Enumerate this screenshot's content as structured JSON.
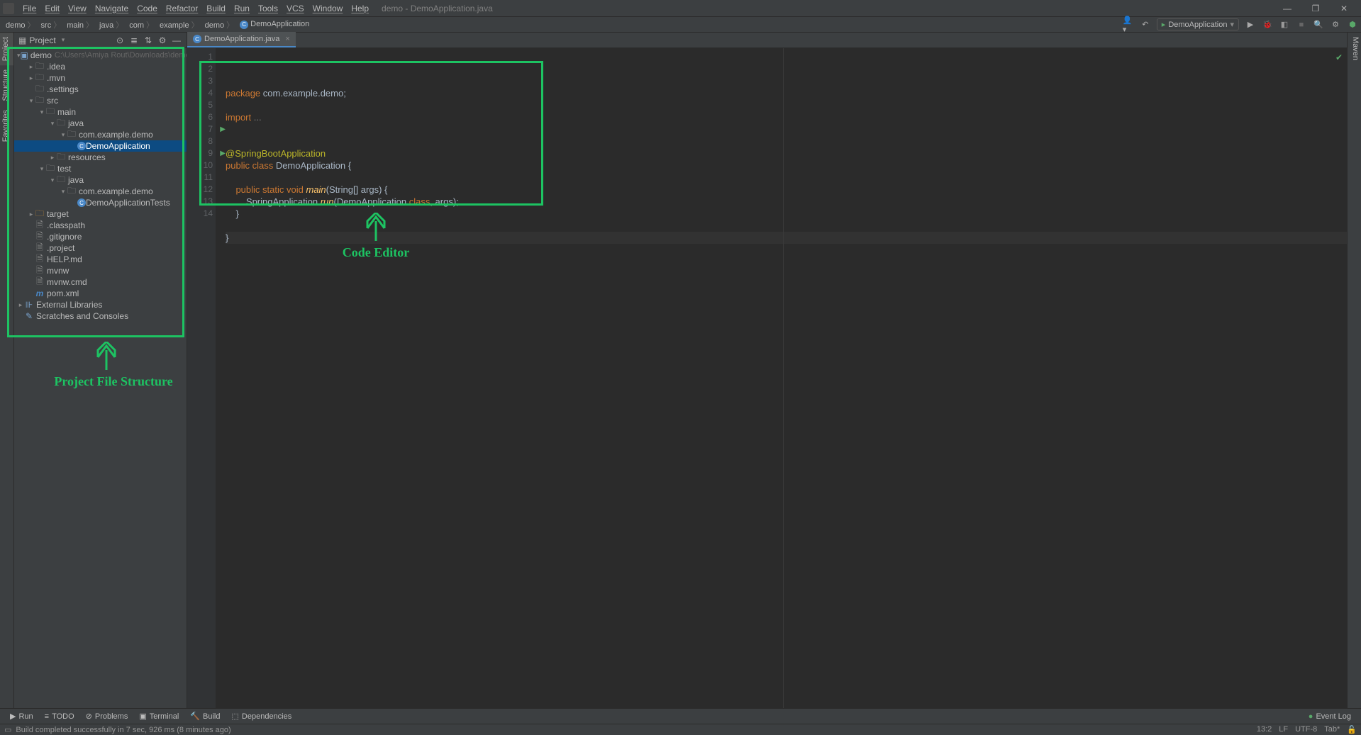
{
  "window": {
    "title": "demo - DemoApplication.java"
  },
  "menu": [
    "File",
    "Edit",
    "View",
    "Navigate",
    "Code",
    "Refactor",
    "Build",
    "Run",
    "Tools",
    "VCS",
    "Window",
    "Help"
  ],
  "breadcrumbs": [
    "demo",
    "src",
    "main",
    "java",
    "com",
    "example",
    "demo",
    "DemoApplication"
  ],
  "runConfig": {
    "name": "DemoApplication"
  },
  "projectHeader": {
    "label": "Project"
  },
  "tree": [
    {
      "d": 0,
      "arrow": "▾",
      "icon": "module",
      "label": "demo",
      "path": "C:\\Users\\Amiya Rout\\Downloads\\demo"
    },
    {
      "d": 1,
      "arrow": "▸",
      "icon": "folder",
      "label": ".idea"
    },
    {
      "d": 1,
      "arrow": "▸",
      "icon": "folder",
      "label": ".mvn"
    },
    {
      "d": 1,
      "arrow": " ",
      "icon": "folder",
      "label": ".settings"
    },
    {
      "d": 1,
      "arrow": "▾",
      "icon": "folder",
      "label": "src"
    },
    {
      "d": 2,
      "arrow": "▾",
      "icon": "folder",
      "label": "main"
    },
    {
      "d": 3,
      "arrow": "▾",
      "icon": "folder",
      "label": "java"
    },
    {
      "d": 4,
      "arrow": "▾",
      "icon": "folder",
      "label": "com.example.demo"
    },
    {
      "d": 5,
      "arrow": " ",
      "icon": "class",
      "label": "DemoApplication",
      "selected": true
    },
    {
      "d": 3,
      "arrow": "▸",
      "icon": "folder",
      "label": "resources"
    },
    {
      "d": 2,
      "arrow": "▾",
      "icon": "folder",
      "label": "test"
    },
    {
      "d": 3,
      "arrow": "▾",
      "icon": "folder",
      "label": "java"
    },
    {
      "d": 4,
      "arrow": "▾",
      "icon": "folder",
      "label": "com.example.demo"
    },
    {
      "d": 5,
      "arrow": " ",
      "icon": "class",
      "label": "DemoApplicationTests"
    },
    {
      "d": 1,
      "arrow": "▸",
      "icon": "folder-orange",
      "label": "target"
    },
    {
      "d": 1,
      "arrow": " ",
      "icon": "file",
      "label": ".classpath"
    },
    {
      "d": 1,
      "arrow": " ",
      "icon": "file",
      "label": ".gitignore"
    },
    {
      "d": 1,
      "arrow": " ",
      "icon": "file",
      "label": ".project"
    },
    {
      "d": 1,
      "arrow": " ",
      "icon": "file",
      "label": "HELP.md"
    },
    {
      "d": 1,
      "arrow": " ",
      "icon": "file",
      "label": "mvnw"
    },
    {
      "d": 1,
      "arrow": " ",
      "icon": "file",
      "label": "mvnw.cmd"
    },
    {
      "d": 1,
      "arrow": " ",
      "icon": "maven",
      "label": "pom.xml"
    },
    {
      "d": 0,
      "arrow": "▸",
      "icon": "lib",
      "label": "External Libraries"
    },
    {
      "d": 0,
      "arrow": " ",
      "icon": "scratch",
      "label": "Scratches and Consoles"
    }
  ],
  "tab": {
    "name": "DemoApplication.java"
  },
  "code": {
    "lines": [
      {
        "n": 1,
        "html": "<span class='kw'>package</span> com.example.demo;"
      },
      {
        "n": 2,
        "html": ""
      },
      {
        "n": 3,
        "html": "<span class='kw'>import</span> <span class='cm'>...</span>"
      },
      {
        "n": 4,
        "html": ""
      },
      {
        "n": 5,
        "html": ""
      },
      {
        "n": 6,
        "html": "<span class='ann'>@SpringBootApplication</span>"
      },
      {
        "n": 7,
        "html": "<span class='kw'>public class</span> DemoApplication {"
      },
      {
        "n": 8,
        "html": ""
      },
      {
        "n": 9,
        "html": "    <span class='kw'>public static void</span> <span class='fn'>main</span>(String[] args) {"
      },
      {
        "n": 10,
        "html": "        SpringApplication.<span class='fn'>run</span>(DemoApplication.<span class='kw'>class</span>, args);"
      },
      {
        "n": 11,
        "html": "    }"
      },
      {
        "n": 12,
        "html": ""
      },
      {
        "n": 13,
        "html": "}",
        "caret": true
      },
      {
        "n": 14,
        "html": ""
      }
    ]
  },
  "leftGutter": [
    {
      "label": "Project",
      "active": true
    },
    {
      "label": "Structure"
    },
    {
      "label": "Favorites"
    }
  ],
  "rightGutter": [
    {
      "label": "Maven"
    }
  ],
  "bottomTabs": {
    "left": [
      {
        "icon": "▶",
        "label": "Run"
      },
      {
        "icon": "≡",
        "label": "TODO"
      },
      {
        "icon": "⊘",
        "label": "Problems"
      },
      {
        "icon": "▣",
        "label": "Terminal"
      },
      {
        "icon": "🔨",
        "label": "Build"
      },
      {
        "icon": "⬚",
        "label": "Dependencies"
      }
    ],
    "right": [
      {
        "icon": "●",
        "label": "Event Log"
      }
    ]
  },
  "status": {
    "msg": "Build completed successfully in 7 sec, 926 ms (8 minutes ago)",
    "pos": "13:2",
    "lf": "LF",
    "enc": "UTF-8",
    "ind": "Tab*"
  },
  "annotations": {
    "projectLabel": "Project File Structure",
    "editorLabel": "Code Editor"
  }
}
